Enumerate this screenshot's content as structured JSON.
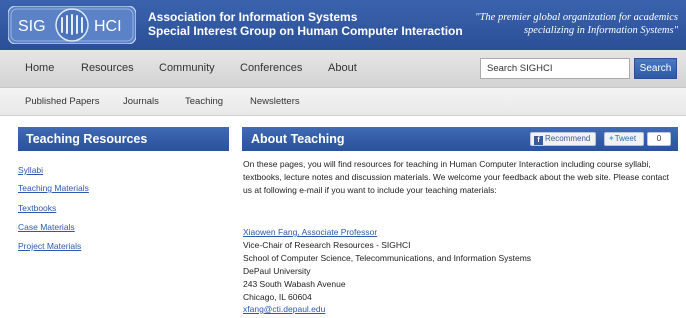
{
  "header": {
    "logo": {
      "left_text": "SIG",
      "right_text": "HCI"
    },
    "title_line1": "Association for Information Systems",
    "title_line2": "Special Interest Group on Human Computer Interaction",
    "tagline_line1": "\"The premier global organization for academics",
    "tagline_line2": "specializing in Information Systems\""
  },
  "main_nav": {
    "items": [
      "Home",
      "Resources",
      "Community",
      "Conferences",
      "About"
    ],
    "search": {
      "value": "Search SIGHCI",
      "button_label": "Search"
    }
  },
  "sub_nav": {
    "items": [
      "Published Papers",
      "Journals",
      "Teaching",
      "Newsletters"
    ]
  },
  "sidebar": {
    "title": "Teaching Resources",
    "links": [
      "Syllabi",
      "Teaching Materials",
      "Textbooks",
      "Case Materials",
      "Project Materials"
    ]
  },
  "main": {
    "title": "About Teaching",
    "social": {
      "recommend_label": "Recommend",
      "tweet_label": "Tweet",
      "tweet_count": "0"
    },
    "intro": "On these pages, you will find resources for teaching in Human Computer Interaction including course syllabi, textbooks, lecture notes and discussion materials. We welcome your feedback about the web site. Please contact us at following e-mail if you want to include your teaching materials:",
    "contact": {
      "name": "Xiaowen Fang, Associate Professor",
      "role": "Vice-Chair of Research Resources - SIGHCI",
      "school": "School of Computer Science, Telecommunications, and Information Systems",
      "university": "DePaul University",
      "street": "243 South Wabash Avenue",
      "city": "Chicago, IL 60604",
      "email": "xfang@cti.depaul.edu"
    }
  },
  "colors": {
    "brand_blue": "#2b529c",
    "link_blue": "#2b58b0"
  }
}
